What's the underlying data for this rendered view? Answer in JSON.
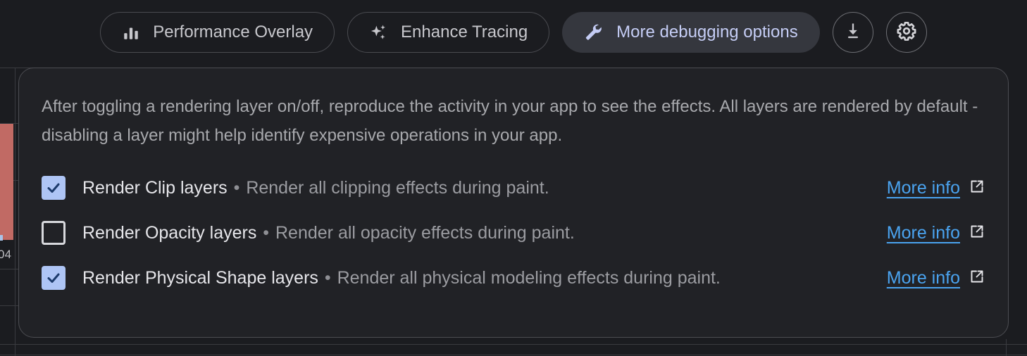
{
  "toolbar": {
    "buttons": [
      {
        "label": "Performance Overlay",
        "icon": "bar-chart-icon",
        "active": false
      },
      {
        "label": "Enhance Tracing",
        "icon": "sparkles-icon",
        "active": false
      },
      {
        "label": "More debugging options",
        "icon": "wrench-icon",
        "active": true
      }
    ],
    "icon_buttons": [
      {
        "name": "download-button",
        "icon": "download-icon"
      },
      {
        "name": "settings-button",
        "icon": "gear-icon"
      }
    ]
  },
  "panel": {
    "description": "After toggling a rendering layer on/off, reproduce the activity in your app to see the effects. All layers are rendered by default - disabling a layer might help identify expensive operations in your app.",
    "separator": "•",
    "options": [
      {
        "title": "Render Clip layers",
        "subtitle": "Render all clipping effects during paint.",
        "checked": true,
        "link_label": "More info"
      },
      {
        "title": "Render Opacity layers",
        "subtitle": "Render all opacity effects during paint.",
        "checked": false,
        "link_label": "More info"
      },
      {
        "title": "Render Physical Shape layers",
        "subtitle": "Render all physical modeling effects during paint.",
        "checked": true,
        "link_label": "More info"
      }
    ]
  },
  "background": {
    "axis_label": "04",
    "bar_color": "#c16a64",
    "bar_accent_color": "#a9c3e8"
  },
  "colors": {
    "page_bg": "#1b1c20",
    "panel_bg": "#212226",
    "accent_active_text": "#c5cdf5",
    "checkbox_on": "#aec5f5",
    "link": "#4aa3ef"
  }
}
